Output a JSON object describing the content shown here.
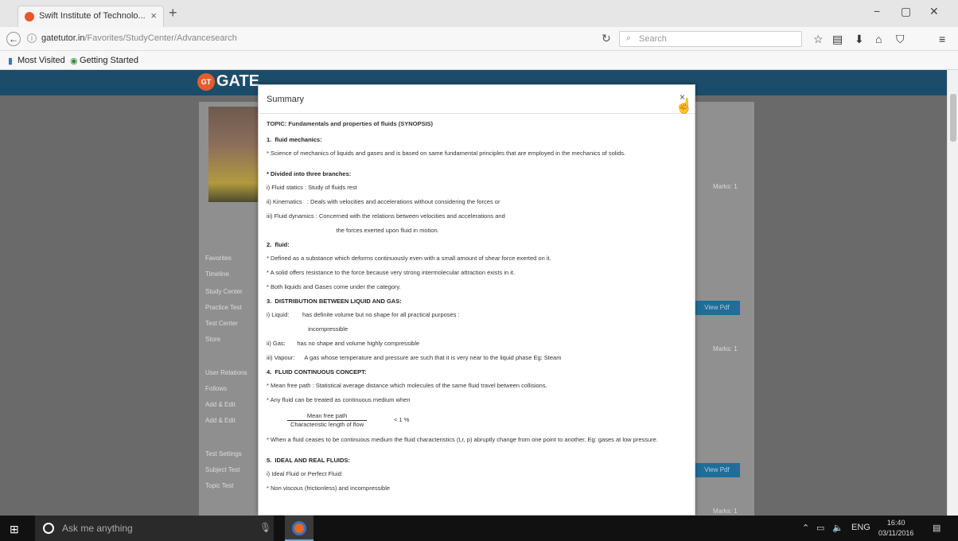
{
  "browser": {
    "tab_title": "Swift Institute of Technolo...",
    "tab_close": "×",
    "new_tab": "+",
    "url_domain": "gatetutor.in",
    "url_path": "/Favorites/StudyCenter/Advancesearch",
    "search_placeholder": "Search",
    "bookmarks": [
      "Most Visited",
      "Getting Started"
    ],
    "window_controls": [
      "−",
      "▢",
      "✕"
    ]
  },
  "site": {
    "logo_badge": "GT",
    "logo_text": "GATE",
    "left_menu": [
      "Favorites",
      "Timeline",
      "Study Center",
      "Practice Test",
      "Test Center",
      "Store",
      "User Relations",
      "Follows",
      "Add & Edit",
      "Add & Edit",
      "Test Settings",
      "Subject Test",
      "Topic Test"
    ],
    "right_marks": [
      "Marks: 1",
      "Marks: 1",
      "Marks: 1"
    ],
    "right_buttons": [
      "View Pdf",
      "View Pdf"
    ]
  },
  "modal": {
    "title": "Summary",
    "close": "×",
    "topic_line": "TOPIC:  Fundamentals and properties of fluids        (SYNOPSIS)",
    "lines": [
      {
        "t": "1.  fluid mechanics:",
        "h": true
      },
      {
        "t": "* Science of mechanics of liquids and gases and is based on same fundamental principles that are employed in the mechanics of solids.",
        "h": false,
        "wrap": true
      },
      {
        "t": "* Divided into three branches:",
        "h": true
      },
      {
        "t": "i) Fluid statics : Study of fluids rest",
        "h": false
      },
      {
        "t": "ii) Kinematics   : Deals with velocities and accelerations without considering the forces or",
        "h": false
      },
      {
        "t": "iii) Fluid dynamics : Concerned with the relations between velocities and accelerations and",
        "h": false
      },
      {
        "t": "                                          the forces exerted upon fluid in motion.",
        "h": false
      },
      {
        "t": "2.  fluid:",
        "h": true
      },
      {
        "t": "* Defined as a substance which deforms continuously even with a small amount of shear force exerted on it.",
        "h": false
      },
      {
        "t": "* A solid offers resistance to the force because very strong intermolecular attraction exists in it.",
        "h": false
      },
      {
        "t": "* Both liquids and Gases come under the category.",
        "h": false
      },
      {
        "t": "3.  DISTRIBUTION BETWEEN LIQUID AND GAS:",
        "h": true
      },
      {
        "t": "i) Liquid:        has definite volume but no shape for all practical purposes :",
        "h": false
      },
      {
        "t": "                         incompressible",
        "h": false
      },
      {
        "t": "ii) Gas:       has no shape and volume highly compressible",
        "h": false
      },
      {
        "t": "iii) Vapour:      A gas whose temperature and pressure are such that it is very near to the liquid phase Eg: Steam",
        "h": false
      },
      {
        "t": "4.  FLUID CONTINUOUS CONCEPT:",
        "h": true
      },
      {
        "t": "* Mean free path : Statistical average distance which molecules of the same fluid travel between collisions.",
        "h": false
      },
      {
        "t": "* Any fluid can be treated as continuous medium when",
        "h": false
      }
    ],
    "fraction_num": "Mean free path",
    "fraction_den": "Characteristic length of flow",
    "fraction_rhs": "< 1 %",
    "lines_after": [
      {
        "t": "* When a fluid ceases to be continuous medium the fluid characteristics (t,r,  p) abruptly change from one point to another. Eg: gases at low pressure.",
        "h": false,
        "wrap": true
      },
      {
        "t": "5.  IDEAL AND REAL FLUIDS:",
        "h": true
      },
      {
        "t": "i) Ideal Fluid or Perfect Fluid:",
        "h": false
      },
      {
        "t": "* Non viscous (frictionless) and incompressible",
        "h": false
      }
    ]
  },
  "taskbar": {
    "search_text": "Ask me anything",
    "lang": "ENG",
    "time": "16:40",
    "date": "03/11/2016"
  }
}
